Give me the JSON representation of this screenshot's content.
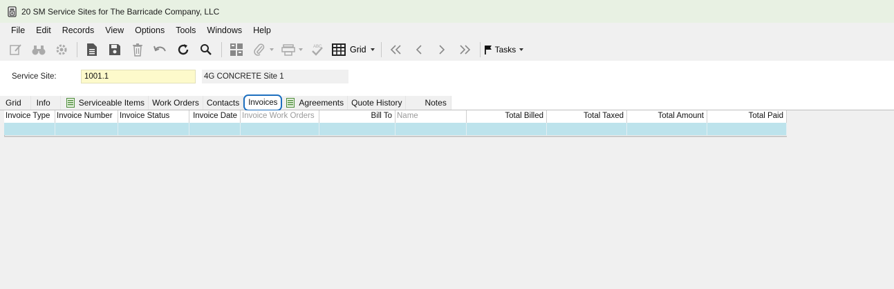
{
  "window": {
    "title": "20 SM Service Sites for The Barricade Company, LLC",
    "icon": "form-document-icon"
  },
  "menu": [
    "File",
    "Edit",
    "Records",
    "View",
    "Options",
    "Tools",
    "Windows",
    "Help"
  ],
  "toolbar": {
    "grid_label": "Grid",
    "tasks_label": "Tasks"
  },
  "form": {
    "service_site_label": "Service Site:",
    "service_site_value": "1001.1",
    "service_site_name": "4G CONCRETE Site 1"
  },
  "tabs": [
    {
      "label": "Grid"
    },
    {
      "label": "Info"
    },
    {
      "label": "Serviceable Items",
      "icon": "spreadsheet-icon"
    },
    {
      "label": "Work Orders"
    },
    {
      "label": "Contacts"
    },
    {
      "label": "Invoices",
      "active": true
    },
    {
      "label": "Agreements",
      "icon": "spreadsheet-icon"
    },
    {
      "label": "Quote History"
    },
    {
      "label": "Notes"
    }
  ],
  "grid": {
    "columns": [
      {
        "label": "Invoice Type"
      },
      {
        "label": "Invoice Number"
      },
      {
        "label": "Invoice Status"
      },
      {
        "label": "Invoice Date",
        "align": "right"
      },
      {
        "label": "Invoice Work Orders",
        "disabled": true
      },
      {
        "label": "Bill To",
        "align": "right"
      },
      {
        "label": "Name",
        "disabled": true
      },
      {
        "label": "Total Billed",
        "align": "right"
      },
      {
        "label": "Total Taxed",
        "align": "right"
      },
      {
        "label": "Total Amount",
        "align": "right"
      },
      {
        "label": "Total Paid",
        "align": "right"
      }
    ],
    "rows": [
      [
        "",
        "",
        "",
        "",
        "",
        "",
        "",
        "",
        "",
        "",
        ""
      ]
    ]
  },
  "colors": {
    "title_bar": "#e8f1e3",
    "highlight_input": "#fdfacb",
    "active_tab_ring": "#1d6fbf",
    "selected_row": "#bde3ec"
  }
}
